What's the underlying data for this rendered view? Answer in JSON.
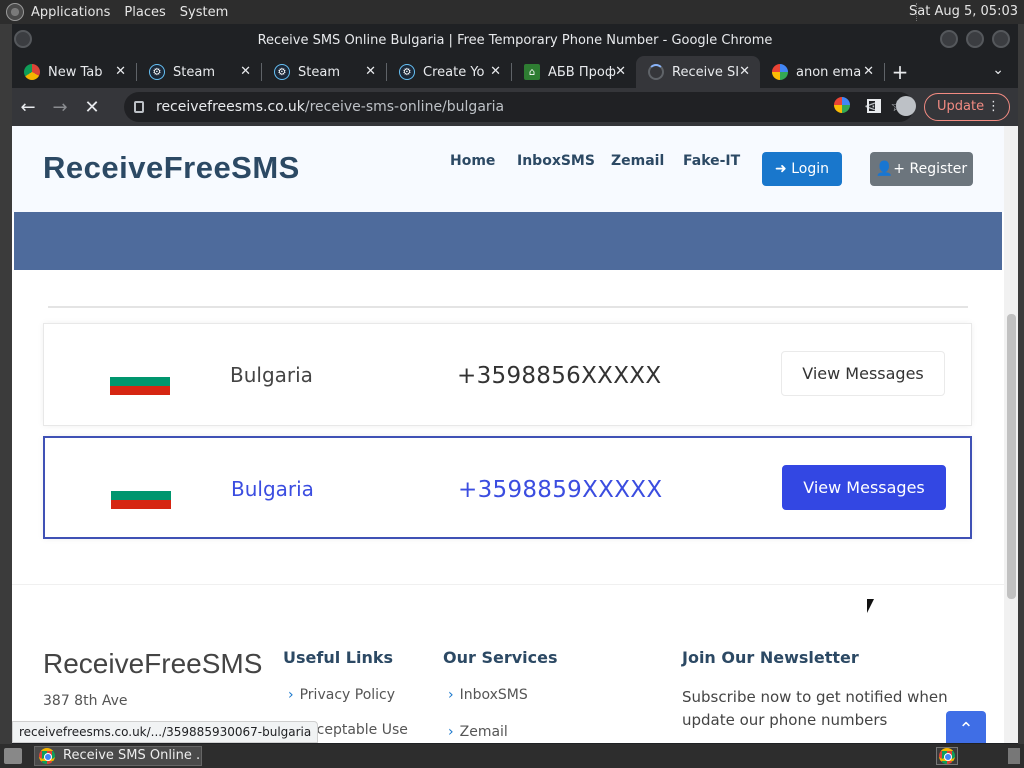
{
  "panel": {
    "applications": "Applications",
    "places": "Places",
    "system": "System",
    "clock": "Sat Aug  5, 05:03"
  },
  "window": {
    "title": "Receive SMS Online Bulgaria | Free Temporary Phone Number - Google Chrome"
  },
  "tabs": [
    {
      "title": "New Tab",
      "icon": "chrome-icon"
    },
    {
      "title": "Steam",
      "icon": "steam-icon"
    },
    {
      "title": "Steam",
      "icon": "steam-icon"
    },
    {
      "title": "Create Yo",
      "icon": "steam-icon"
    },
    {
      "title": "АБВ Проф",
      "icon": "house-icon"
    },
    {
      "title": "Receive SI",
      "icon": "loading-icon",
      "active": true
    },
    {
      "title": "anon ema",
      "icon": "google-icon"
    }
  ],
  "toolbar": {
    "url_host": "receivefreesms.co.uk",
    "url_path": "/receive-sms-online/bulgaria",
    "update_label": "Update"
  },
  "site": {
    "logo": "ReceiveFreeSMS",
    "nav": [
      "Home",
      "InboxSMS",
      "Zemail",
      "Fake-IT"
    ],
    "login": "Login",
    "register": "Register"
  },
  "numbers": [
    {
      "country": "Bulgaria",
      "phone": "+3598856XXXXX",
      "button": "View Messages"
    },
    {
      "country": "Bulgaria",
      "phone": "+3598859XXXXX",
      "button": "View Messages"
    }
  ],
  "footer": {
    "brand": "ReceiveFreeSMS",
    "address": "387 8th Ave",
    "useful_links_title": "Useful Links",
    "useful_links": [
      "Privacy Policy",
      "Acceptable Use"
    ],
    "services_title": "Our Services",
    "services": [
      "InboxSMS",
      "Zemail"
    ],
    "newsletter_title": "Join Our Newsletter",
    "newsletter_text": "Subscribe now to get notified when update our phone numbers"
  },
  "status_url": "receivefreesms.co.uk/.../359885930067-bulgaria",
  "taskbar": {
    "task_label": "Receive SMS Online ..."
  },
  "colors": {
    "primary": "#1977cc",
    "accent_blue": "#3347e3",
    "brand_text": "#2c4964",
    "banner": "#4e6b9c"
  }
}
